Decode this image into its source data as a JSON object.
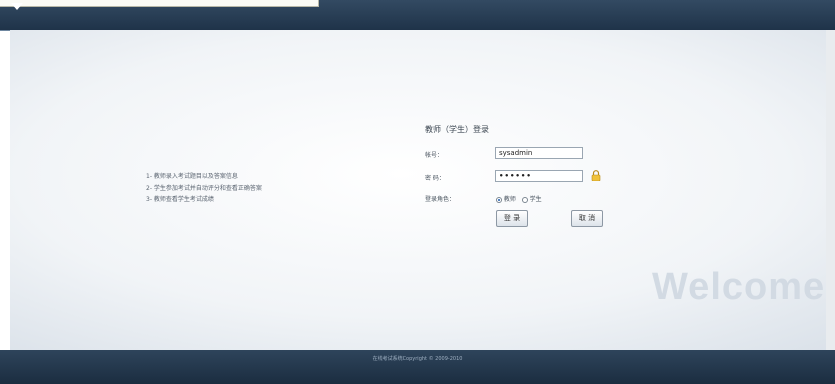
{
  "app": {
    "welcome_text": "Welcome"
  },
  "info": {
    "items": [
      "1- 教师录入考试题目以及答案信息",
      "2- 学生参加考试并自动评分和查看正确答案",
      "3- 教师查看学生考试成绩"
    ]
  },
  "login": {
    "title": "教师（学生）登录",
    "id_label": "帐号：",
    "id_value": "sysadmin",
    "password_label": "密 码：",
    "password_value": "••••••",
    "role_label": "登录角色：",
    "role_options": [
      "教师",
      "学生"
    ],
    "role_selected": "教师",
    "login_button": "登 录",
    "cancel_button": "取 消"
  },
  "footer": {
    "copyright": "在线考试系统Copyright © 2009-2010"
  },
  "colors": {
    "header": "#22374d",
    "footer": "#1f3246",
    "accent": "#1a5cb0"
  },
  "icons": [
    "lock-icon",
    "dropdown-arrow-icon"
  ]
}
